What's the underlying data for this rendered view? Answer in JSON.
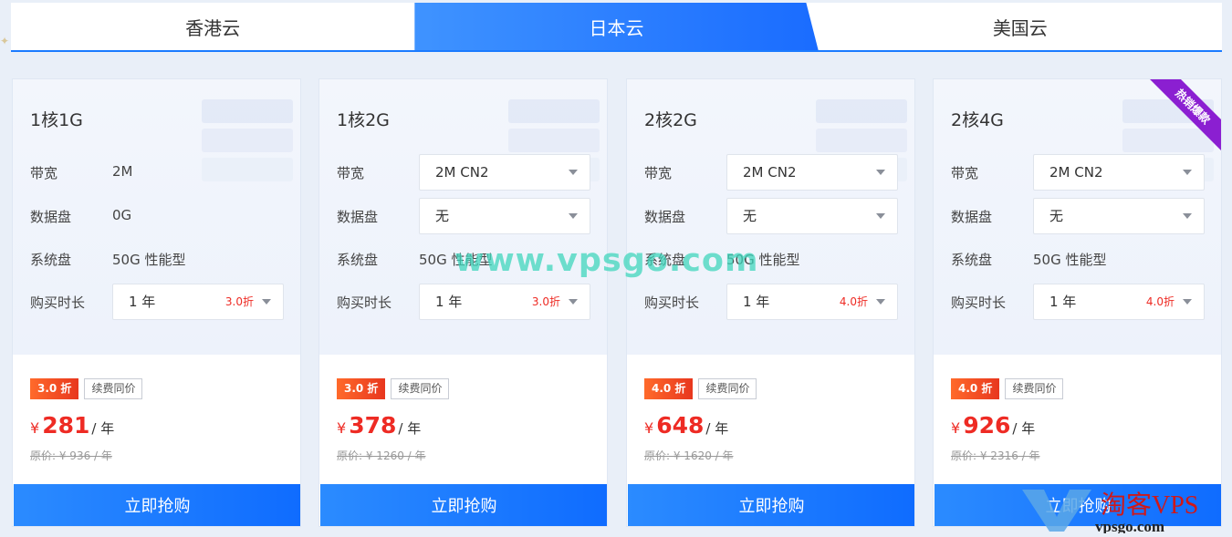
{
  "tabs": [
    {
      "label": "香港云",
      "active": false
    },
    {
      "label": "日本云",
      "active": true
    },
    {
      "label": "美国云",
      "active": false
    }
  ],
  "labels": {
    "bandwidth": "带宽",
    "data_disk": "数据盘",
    "system_disk": "系统盘",
    "duration": "购买时长",
    "renew_same": "续费同价",
    "buy": "立即抢购",
    "per_year": "/ 年",
    "yen": "¥"
  },
  "cards": [
    {
      "title": "1核1G",
      "bandwidth": "2M",
      "data_disk": "0G",
      "system_disk": "50G 性能型",
      "duration": "1 年",
      "duration_discount": "3.0折",
      "discount_badge": "3.0 折",
      "price": "281",
      "original": "原价: ¥ 936 / 年",
      "hot": false
    },
    {
      "title": "1核2G",
      "bandwidth": "2M CN2",
      "data_disk": "无",
      "system_disk": "50G 性能型",
      "duration": "1 年",
      "duration_discount": "3.0折",
      "discount_badge": "3.0 折",
      "price": "378",
      "original": "原价: ¥ 1260 / 年",
      "hot": false
    },
    {
      "title": "2核2G",
      "bandwidth": "2M CN2",
      "data_disk": "无",
      "system_disk": "50G 性能型",
      "duration": "1 年",
      "duration_discount": "4.0折",
      "discount_badge": "4.0 折",
      "price": "648",
      "original": "原价: ¥ 1620 / 年",
      "hot": false
    },
    {
      "title": "2核4G",
      "bandwidth": "2M CN2",
      "data_disk": "无",
      "system_disk": "50G 性能型",
      "duration": "1 年",
      "duration_discount": "4.0折",
      "discount_badge": "4.0 折",
      "price": "926",
      "original": "原价: ¥ 2316 / 年",
      "hot": true,
      "hot_label": "热销爆款"
    }
  ],
  "watermark": "www.vpsgo.com",
  "logo_watermark": {
    "title": "淘客VPS",
    "sub": "vpsgo.com"
  },
  "colors": {
    "accent": "#1b7bff",
    "price": "#ee2b24",
    "hot": "#8b1fd1"
  }
}
